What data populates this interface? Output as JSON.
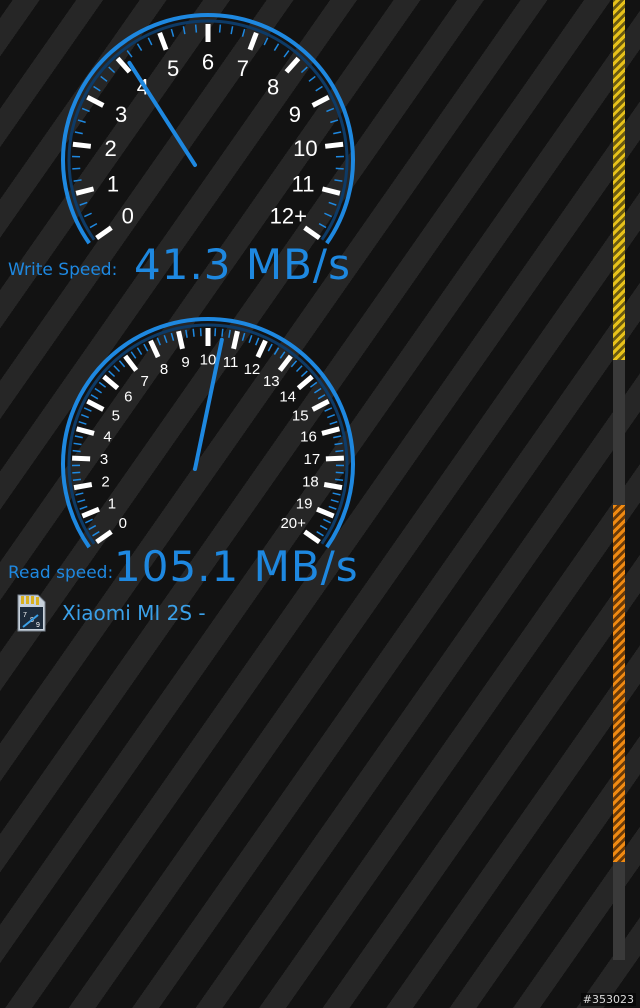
{
  "write": {
    "label": "Write Speed:",
    "value": "41.3 MB/s",
    "speed": 41.3,
    "scale_labels": [
      "0",
      "1",
      "2",
      "3",
      "4",
      "5",
      "6",
      "7",
      "8",
      "9",
      "10",
      "11",
      "12+"
    ]
  },
  "read": {
    "label": "Read speed:",
    "value": "105.1 MB/s",
    "speed": 105.1,
    "scale_labels": [
      "0",
      "1",
      "2",
      "3",
      "4",
      "5",
      "6",
      "7",
      "8",
      "9",
      "10",
      "11",
      "12",
      "13",
      "14",
      "15",
      "16",
      "17",
      "18",
      "19",
      "20+"
    ]
  },
  "device": {
    "name": "Xiaomi MI 2S -",
    "icon": "sd-card-icon"
  },
  "watermark": "#353023",
  "colors": {
    "accent": "#1e88e0",
    "scrollbar_top": "#e8c21a",
    "scrollbar_bottom": "#f08a12"
  }
}
